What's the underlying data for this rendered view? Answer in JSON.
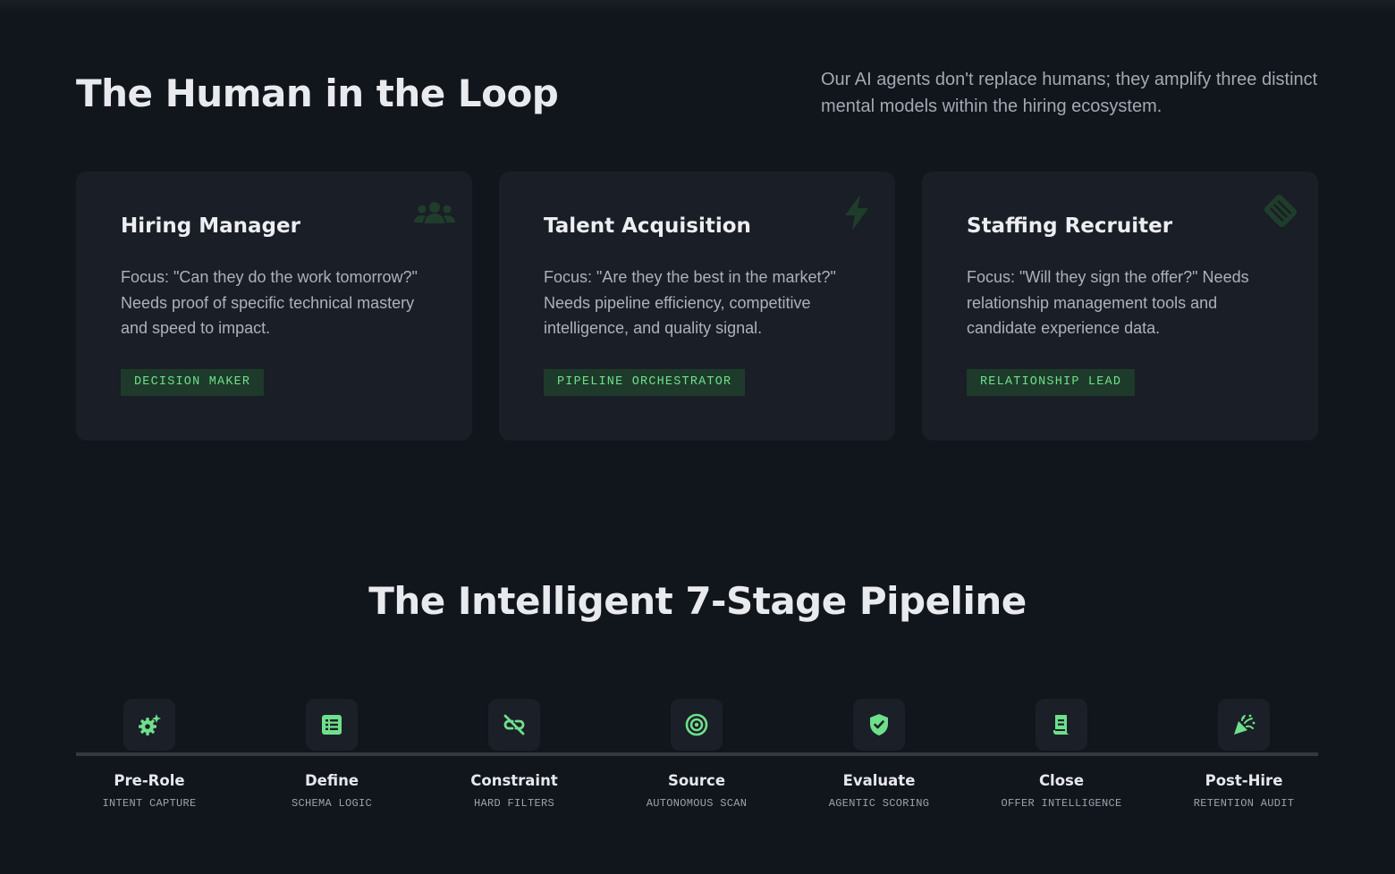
{
  "header": {
    "title": "The Human in the Loop",
    "subtitle": "Our AI agents don't replace humans; they amplify three distinct mental models within the hiring ecosystem."
  },
  "cards": [
    {
      "title": "Hiring Manager",
      "description": "Focus: \"Can they do the work tomorrow?\" Needs proof of specific technical mastery and speed to impact.",
      "tag": "DECISION MAKER",
      "icon": "people-group-icon"
    },
    {
      "title": "Talent Acquisition",
      "description": "Focus: \"Are they the best in the market?\" Needs pipeline efficiency, competitive intelligence, and quality signal.",
      "tag": "PIPELINE ORCHESTRATOR",
      "icon": "lightning-bolt-icon"
    },
    {
      "title": "Staffing Recruiter",
      "description": "Focus: \"Will they sign the offer?\" Needs relationship management tools and candidate experience data.",
      "tag": "RELATIONSHIP LEAD",
      "icon": "handshake-icon"
    }
  ],
  "pipeline": {
    "title": "The Intelligent 7-Stage Pipeline",
    "stages": [
      {
        "name": "Pre-Role",
        "sub": "INTENT CAPTURE",
        "icon": "gear-sparkle-icon"
      },
      {
        "name": "Define",
        "sub": "SCHEMA LOGIC",
        "icon": "list-document-icon"
      },
      {
        "name": "Constraint",
        "sub": "HARD FILTERS",
        "icon": "broken-link-icon"
      },
      {
        "name": "Source",
        "sub": "AUTONOMOUS SCAN",
        "icon": "radar-target-icon"
      },
      {
        "name": "Evaluate",
        "sub": "AGENTIC SCORING",
        "icon": "shield-check-icon"
      },
      {
        "name": "Close",
        "sub": "OFFER INTELLIGENCE",
        "icon": "receipt-icon"
      },
      {
        "name": "Post-Hire",
        "sub": "RETENTION AUDIT",
        "icon": "party-popper-icon"
      }
    ]
  },
  "colors": {
    "background": "#11151c",
    "card": "#1a1e26",
    "accent": "#6ee08c",
    "tag_background": "#1e3a2a",
    "watermark_icon": "#1f3d2b"
  }
}
